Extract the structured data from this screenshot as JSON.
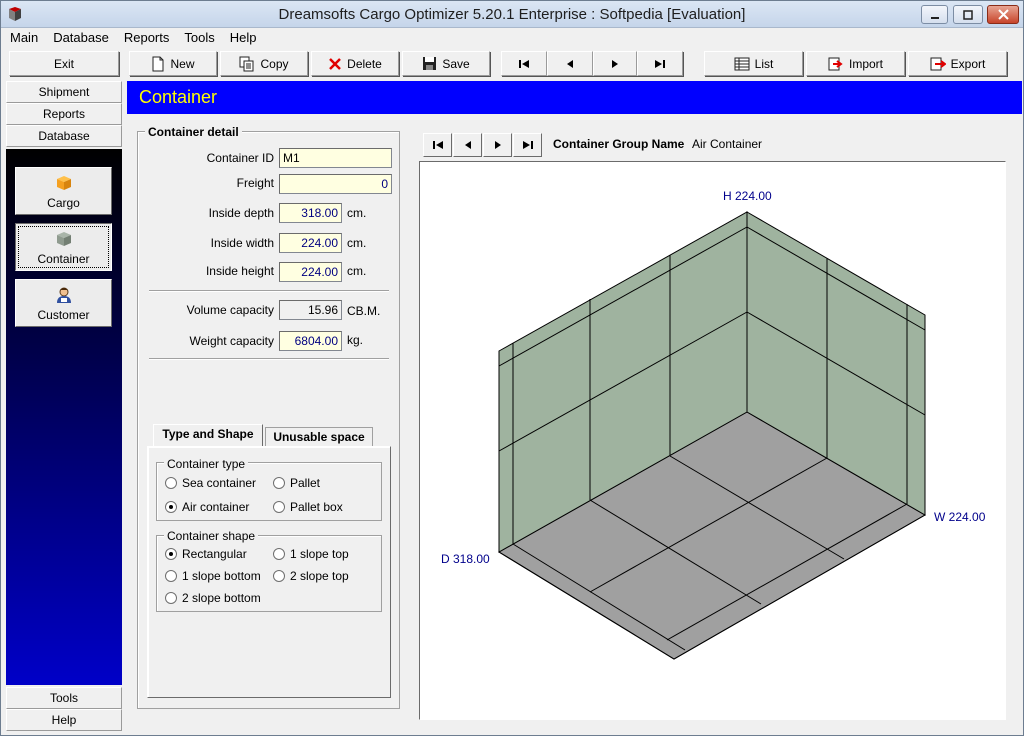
{
  "window": {
    "title": "Dreamsofts Cargo Optimizer 5.20.1 Enterprise : Softpedia [Evaluation]"
  },
  "menu": [
    "Main",
    "Database",
    "Reports",
    "Tools",
    "Help"
  ],
  "toolbar": {
    "exit": "Exit",
    "new": "New",
    "copy": "Copy",
    "delete": "Delete",
    "save": "Save",
    "list": "List",
    "import": "Import",
    "export": "Export"
  },
  "sidebar": {
    "shipment": "Shipment",
    "reports": "Reports",
    "database": "Database",
    "items": [
      {
        "label": "Cargo",
        "icon": "cargo-box-icon"
      },
      {
        "label": "Container",
        "icon": "container-icon"
      },
      {
        "label": "Customer",
        "icon": "customer-icon"
      }
    ],
    "tools": "Tools",
    "help": "Help"
  },
  "page": {
    "title": "Container",
    "detail_title": "Container detail",
    "fields": {
      "container_id_label": "Container ID",
      "container_id": "M1",
      "freight_label": "Freight",
      "freight": "0",
      "inside_depth_label": "Inside depth",
      "inside_depth": "318.00",
      "inside_width_label": "Inside width",
      "inside_width": "224.00",
      "inside_height_label": "Inside height",
      "inside_height": "224.00",
      "unit_cm": "cm.",
      "volume_label": "Volume capacity",
      "volume": "15.96",
      "volume_unit": "CB.M.",
      "weight_label": "Weight capacity",
      "weight": "6804.00",
      "weight_unit": "kg."
    },
    "tabs": [
      "Type and Shape",
      "Unusable space"
    ],
    "container_type": {
      "title": "Container type",
      "options": [
        "Sea container",
        "Pallet",
        "Air container",
        "Pallet box"
      ],
      "selected": "Air container"
    },
    "container_shape": {
      "title": "Container shape",
      "options": [
        "Rectangular",
        "1 slope top",
        "1 slope bottom",
        "2 slope top",
        "2 slope bottom"
      ],
      "selected": "Rectangular"
    },
    "group_name_label": "Container Group Name",
    "group_name": "Air Container",
    "view": {
      "h_label": "H 224.00",
      "w_label": "W 224.00",
      "d_label": "D 318.00",
      "wall_color": "#9fb39f",
      "floor_color": "#a0a0a0"
    }
  },
  "colors": {
    "header_bar": "#0000ff",
    "header_text": "#ffff00",
    "field_bg": "#ffffe1"
  }
}
